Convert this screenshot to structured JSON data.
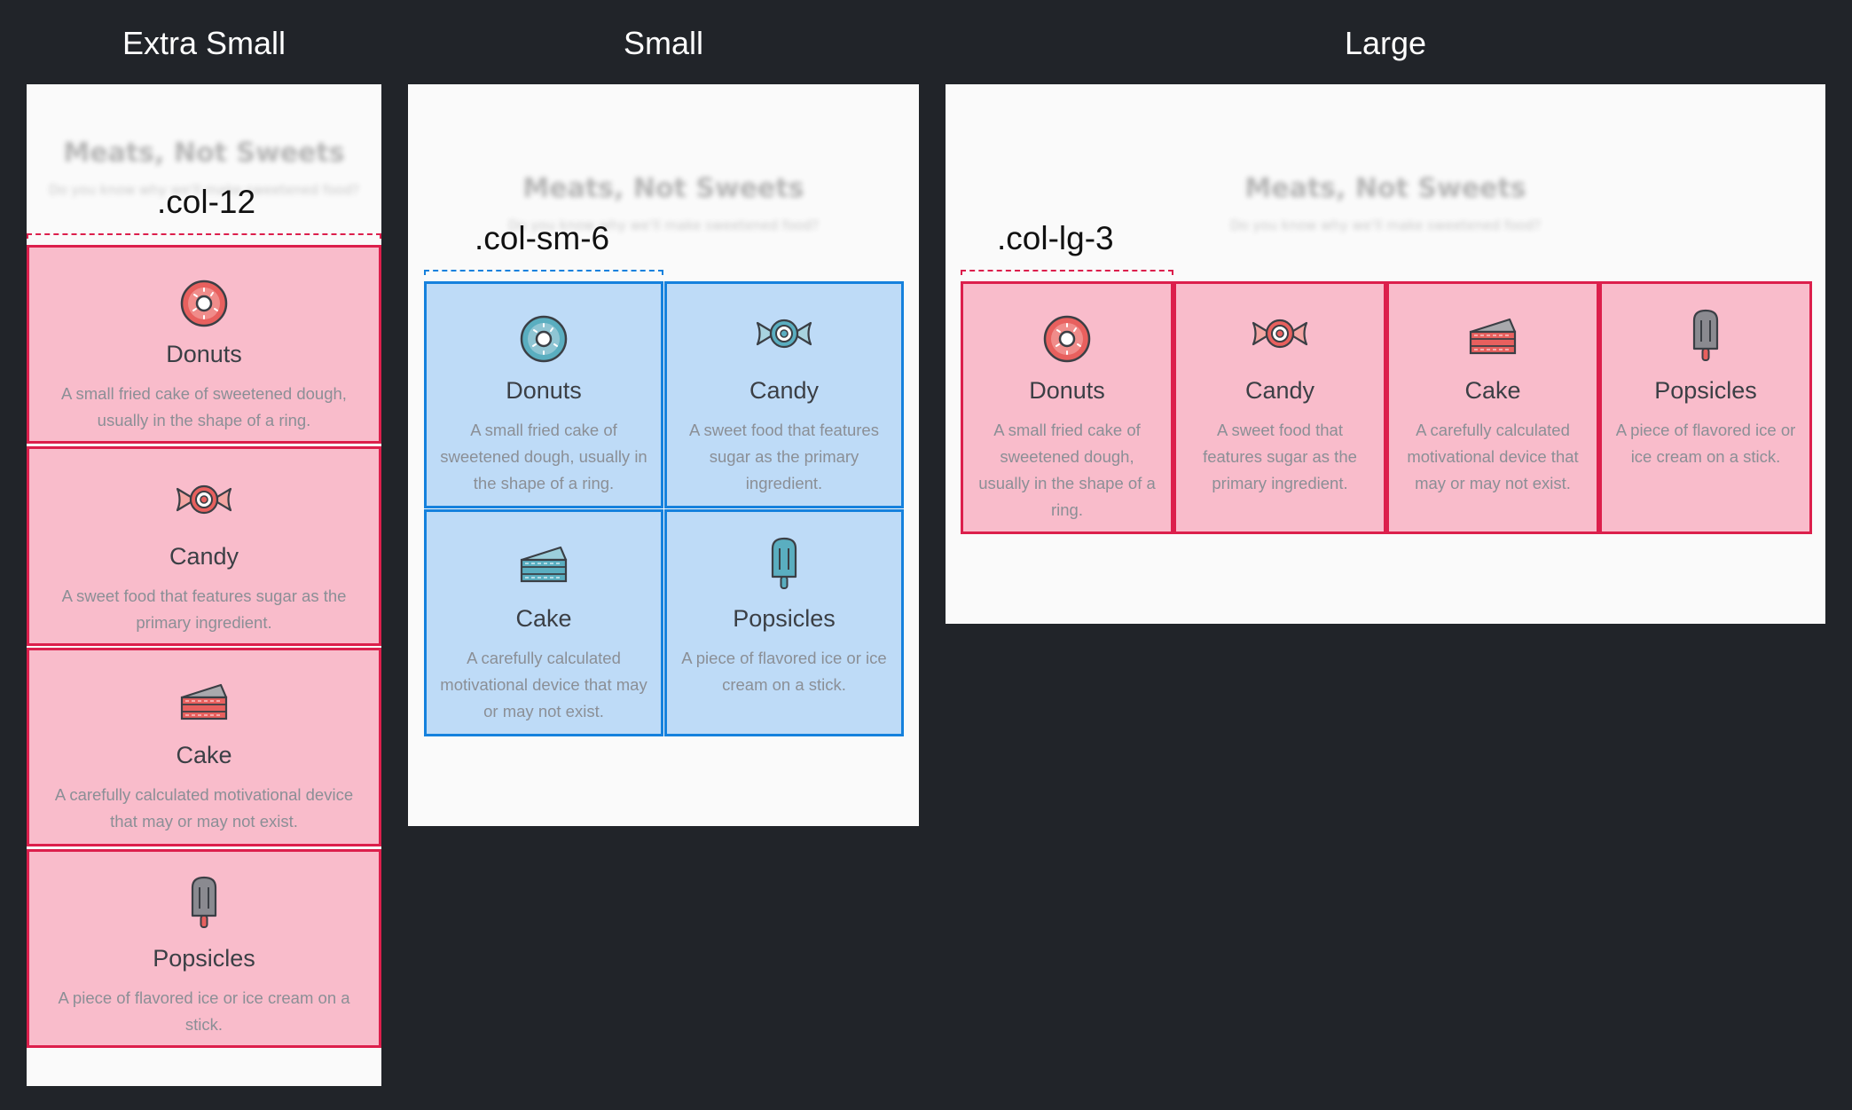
{
  "sections": {
    "xs": {
      "heading": "Extra Small",
      "code_label": ".col-12"
    },
    "sm": {
      "heading": "Small",
      "code_label": ".col-sm-6"
    },
    "lg": {
      "heading": "Large",
      "code_label": ".col-lg-3"
    }
  },
  "page": {
    "title": "Meats, Not Sweets",
    "subtitle": "Do you know why we'll make sweetened food?"
  },
  "items": [
    {
      "icon": "donut-icon",
      "title": "Donuts",
      "desc": "A small fried cake of sweetened dough, usually in the shape of a ring."
    },
    {
      "icon": "candy-icon",
      "title": "Candy",
      "desc": "A sweet food that features sugar as the primary ingredient."
    },
    {
      "icon": "cake-icon",
      "title": "Cake",
      "desc": "A carefully calculated motivational device that may or may not exist."
    },
    {
      "icon": "popsicle-icon",
      "title": "Popsicles",
      "desc": "A piece of flavored ice or ice cream on a stick."
    }
  ],
  "colors": {
    "background": "#212429",
    "frame": "#fafafa",
    "pink_border": "#dc1f4c",
    "pink_fill": "#f9bccb",
    "blue_border": "#1581dd",
    "blue_fill": "#bedbf7"
  }
}
